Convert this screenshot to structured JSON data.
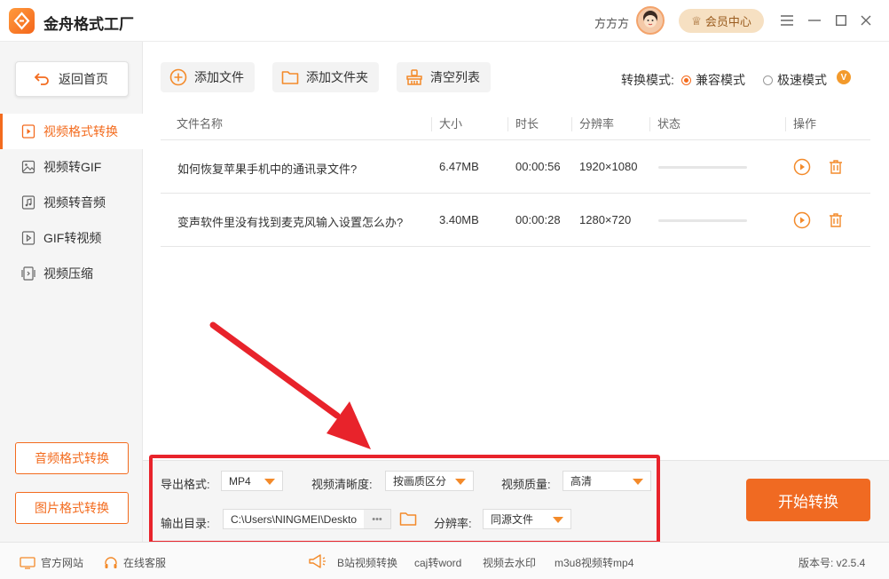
{
  "app": {
    "title": "金舟格式工厂"
  },
  "header": {
    "username": "方方方",
    "member_label": "会员中心"
  },
  "sidebar": {
    "back_label": "返回首页",
    "items": [
      {
        "label": "视频格式转换",
        "icon": "video-file-icon",
        "active": true
      },
      {
        "label": "视频转GIF",
        "icon": "image-icon",
        "active": false
      },
      {
        "label": "视频转音频",
        "icon": "music-file-icon",
        "active": false
      },
      {
        "label": "GIF转视频",
        "icon": "gif-file-icon",
        "active": false
      },
      {
        "label": "视频压缩",
        "icon": "compress-icon",
        "active": false
      }
    ],
    "bottom_buttons": [
      "音频格式转换",
      "图片格式转换"
    ]
  },
  "toolbar": {
    "add_file": "添加文件",
    "add_folder": "添加文件夹",
    "clear_list": "清空列表",
    "mode_label": "转换模式:",
    "mode_compatible": "兼容模式",
    "mode_fast": "极速模式",
    "selected_mode": "兼容模式",
    "vip_badge": "V"
  },
  "table": {
    "columns": [
      "文件名称",
      "大小",
      "时长",
      "分辨率",
      "状态",
      "操作"
    ],
    "rows": [
      {
        "name": "如何恢复苹果手机中的通讯录文件?",
        "size": "6.47MB",
        "duration": "00:00:56",
        "resolution": "1920×1080",
        "progress": 0
      },
      {
        "name": "变声软件里没有找到麦克风输入设置怎么办?",
        "size": "3.40MB",
        "duration": "00:00:28",
        "resolution": "1280×720",
        "progress": 0
      }
    ]
  },
  "settings": {
    "format_label": "导出格式:",
    "format_value": "MP4",
    "clarity_label": "视频清晰度:",
    "clarity_value": "按画质区分",
    "quality_label": "视频质量:",
    "quality_value": "高清",
    "output_label": "输出目录:",
    "output_value": "C:\\Users\\NINGMEI\\Deskto",
    "browse_label": "•••",
    "resolution_label": "分辨率:",
    "resolution_value": "同源文件"
  },
  "start_button": "开始转换",
  "footer": {
    "website": "官方网站",
    "service": "在线客服",
    "links": [
      "B站视频转换",
      "caj转word",
      "视频去水印",
      "m3u8视频转mp4"
    ],
    "version": "版本号: v2.5.4"
  },
  "colors": {
    "accent": "#f36b1e",
    "annotation": "#e8232b"
  }
}
